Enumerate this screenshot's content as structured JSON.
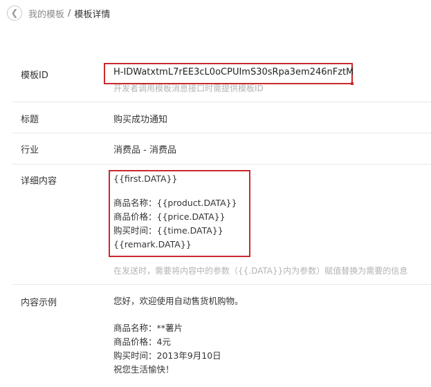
{
  "breadcrumb": {
    "parent": "我的模板",
    "separator": "/",
    "current": "模板详情"
  },
  "template_id": {
    "label": "模板ID",
    "value": "H-IDWatxtmL7rEE3cL0oCPUImS30sRpa3em246nFztM",
    "hint": "开发者调用模板消息接口时需提供模板ID"
  },
  "title": {
    "label": "标题",
    "value": "购买成功通知"
  },
  "industry": {
    "label": "行业",
    "value": "消费品 - 消费品"
  },
  "detail": {
    "label": "详细内容",
    "lines": [
      "{{first.DATA}}",
      "",
      "商品名称：{{product.DATA}}",
      "商品价格：{{price.DATA}}",
      "购买时间：{{time.DATA}}",
      "{{remark.DATA}}"
    ],
    "hint": "在发送时，需要将内容中的参数（{{.DATA}}内为参数）赋值替换为需要的信息"
  },
  "example": {
    "label": "内容示例",
    "lines": [
      "您好，欢迎使用自动售货机购物。",
      "",
      "商品名称：**薯片",
      "商品价格：4元",
      "购买时间：2013年9月10日",
      "祝您生活愉快！"
    ]
  },
  "colors": {
    "highlight_border": "#c9282d",
    "divider": "#e7e7e7",
    "hint_text": "#b3b3b3"
  },
  "icons": {
    "back": "chevron-left-icon"
  }
}
